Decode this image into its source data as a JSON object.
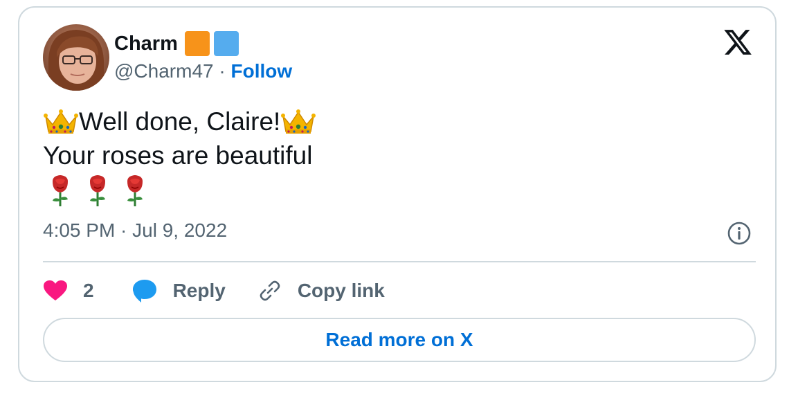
{
  "author": {
    "display_name": "Charm",
    "handle": "@Charm47",
    "separator": "·",
    "follow_label": "Follow",
    "badges": [
      {
        "name": "orange-square",
        "color": "#f7931a"
      },
      {
        "name": "blue-square",
        "color": "#55acee"
      }
    ]
  },
  "tweet": {
    "line1_text": "Well done, Claire!",
    "line2_text": "Your roses are beautiful",
    "leading_emoji": "crown-icon",
    "trailing_emoji": "crown-icon",
    "roses": [
      "rose-icon",
      "rose-icon",
      "rose-icon"
    ]
  },
  "meta": {
    "timestamp": "4:05 PM · Jul 9, 2022"
  },
  "actions": {
    "like_count": "2",
    "reply_label": "Reply",
    "copy_label": "Copy link"
  },
  "read_more_label": "Read more on X",
  "colors": {
    "accent": "#006fd6",
    "heart": "#f91880",
    "reply_bubble": "#1d9bf0",
    "muted_text": "#536471",
    "border": "#cfd9de"
  }
}
